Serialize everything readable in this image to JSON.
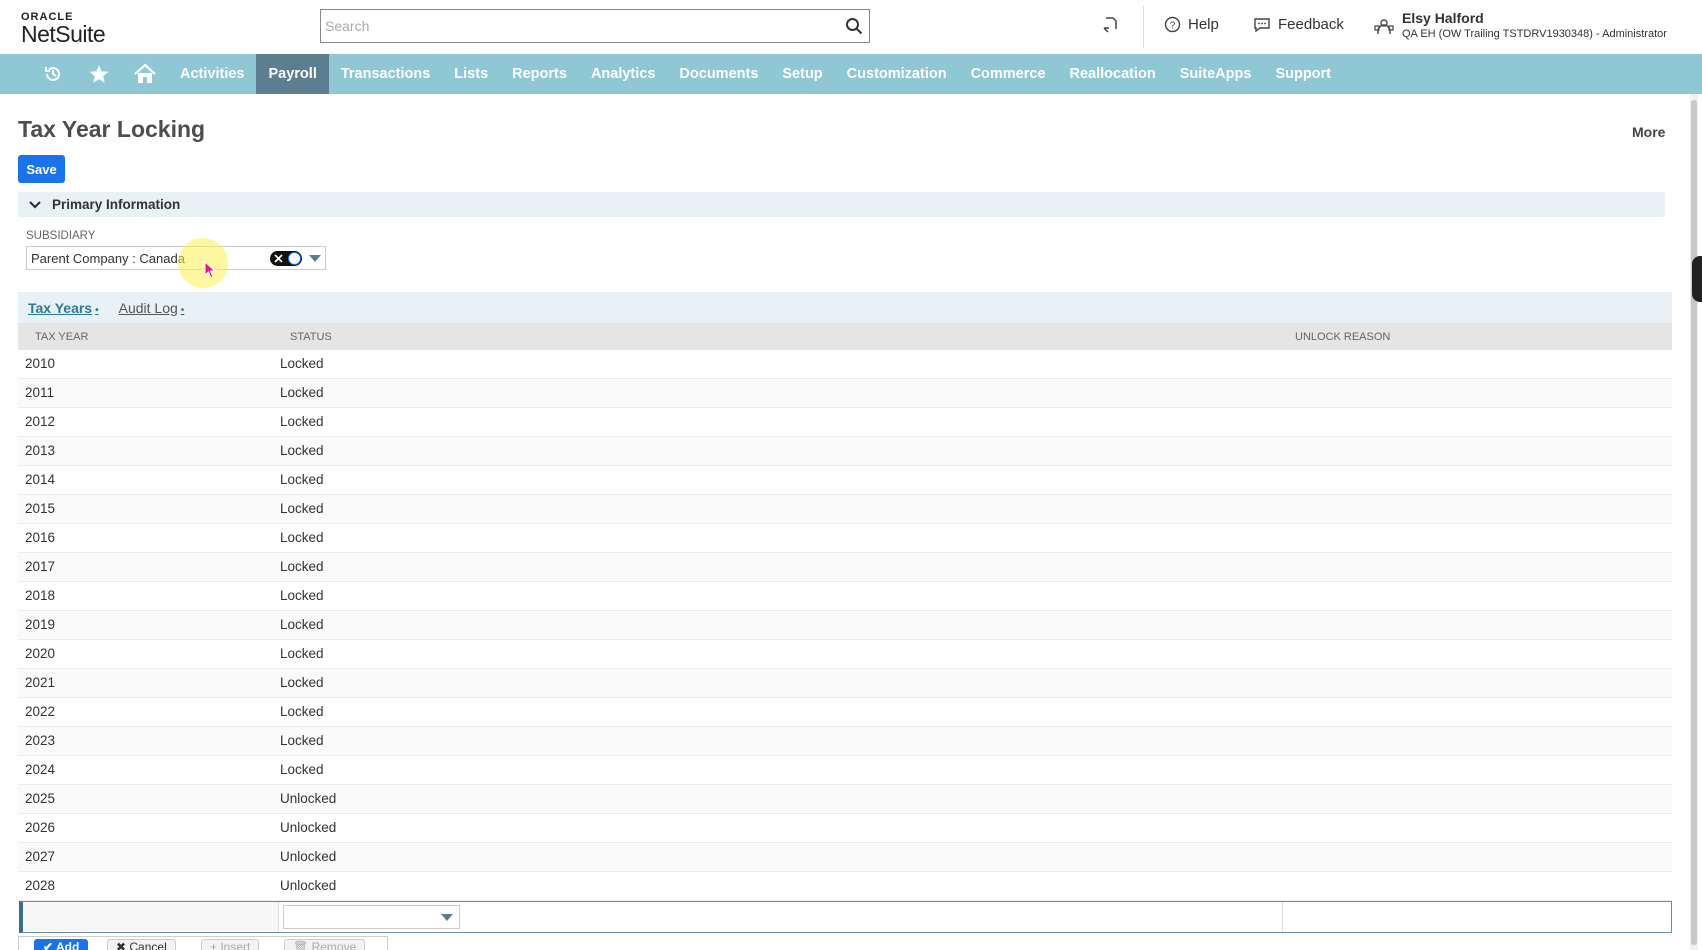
{
  "header": {
    "logo_top": "ORACLE",
    "logo_bottom": "NetSuite",
    "search_placeholder": "Search",
    "help": "Help",
    "feedback": "Feedback",
    "user_name": "Elsy Halford",
    "user_role": "QA EH (OW Trailing TSTDRV1930348) - Administrator"
  },
  "nav": {
    "items": [
      "Activities",
      "Payroll",
      "Transactions",
      "Lists",
      "Reports",
      "Analytics",
      "Documents",
      "Setup",
      "Customization",
      "Commerce",
      "Reallocation",
      "SuiteApps",
      "Support"
    ],
    "active": "Payroll"
  },
  "page": {
    "title": "Tax Year Locking",
    "more": "More",
    "save": "Save",
    "section_title": "Primary Information",
    "subsidiary_label": "SUBSIDIARY",
    "subsidiary_value": "Parent Company : Canada"
  },
  "subtabs": {
    "tax_years": "Tax Years",
    "audit_log": "Audit Log",
    "dot": "•"
  },
  "table": {
    "columns": [
      "TAX YEAR",
      "STATUS",
      "UNLOCK REASON"
    ],
    "rows": [
      {
        "year": "2010",
        "status": "Locked"
      },
      {
        "year": "2011",
        "status": "Locked"
      },
      {
        "year": "2012",
        "status": "Locked"
      },
      {
        "year": "2013",
        "status": "Locked"
      },
      {
        "year": "2014",
        "status": "Locked"
      },
      {
        "year": "2015",
        "status": "Locked"
      },
      {
        "year": "2016",
        "status": "Locked"
      },
      {
        "year": "2017",
        "status": "Locked"
      },
      {
        "year": "2018",
        "status": "Locked"
      },
      {
        "year": "2019",
        "status": "Locked"
      },
      {
        "year": "2020",
        "status": "Locked"
      },
      {
        "year": "2021",
        "status": "Locked"
      },
      {
        "year": "2022",
        "status": "Locked"
      },
      {
        "year": "2023",
        "status": "Locked"
      },
      {
        "year": "2024",
        "status": "Locked"
      },
      {
        "year": "2025",
        "status": "Unlocked"
      },
      {
        "year": "2026",
        "status": "Unlocked"
      },
      {
        "year": "2027",
        "status": "Unlocked"
      },
      {
        "year": "2028",
        "status": "Unlocked"
      }
    ]
  },
  "buttons": {
    "add": "✔ Add",
    "cancel": "✖ Cancel",
    "insert": "+ Insert",
    "remove": "🗑 Remove"
  },
  "colors": {
    "nav_bg": "#8fc7d4",
    "nav_active": "#5b7e90",
    "primary": "#1a73e8"
  }
}
